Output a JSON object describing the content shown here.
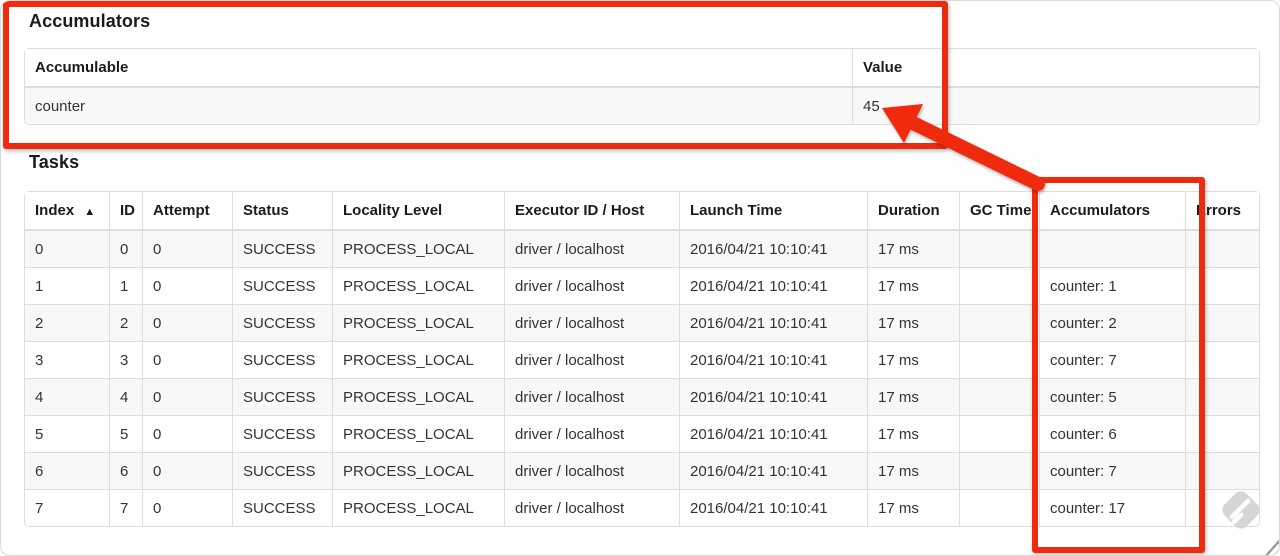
{
  "accumulators": {
    "heading": "Accumulators",
    "columns": [
      "Accumulable",
      "Value"
    ],
    "rows": [
      [
        "counter",
        "45"
      ]
    ]
  },
  "tasks": {
    "heading": "Tasks",
    "sort_icon": "▲",
    "columns": [
      "Index",
      "ID",
      "Attempt",
      "Status",
      "Locality Level",
      "Executor ID / Host",
      "Launch Time",
      "Duration",
      "GC Time",
      "Accumulators",
      "Errors"
    ],
    "rows": [
      [
        "0",
        "0",
        "0",
        "SUCCESS",
        "PROCESS_LOCAL",
        "driver / localhost",
        "2016/04/21 10:10:41",
        "17 ms",
        "",
        "",
        ""
      ],
      [
        "1",
        "1",
        "0",
        "SUCCESS",
        "PROCESS_LOCAL",
        "driver / localhost",
        "2016/04/21 10:10:41",
        "17 ms",
        "",
        "counter: 1",
        ""
      ],
      [
        "2",
        "2",
        "0",
        "SUCCESS",
        "PROCESS_LOCAL",
        "driver / localhost",
        "2016/04/21 10:10:41",
        "17 ms",
        "",
        "counter: 2",
        ""
      ],
      [
        "3",
        "3",
        "0",
        "SUCCESS",
        "PROCESS_LOCAL",
        "driver / localhost",
        "2016/04/21 10:10:41",
        "17 ms",
        "",
        "counter: 7",
        ""
      ],
      [
        "4",
        "4",
        "0",
        "SUCCESS",
        "PROCESS_LOCAL",
        "driver / localhost",
        "2016/04/21 10:10:41",
        "17 ms",
        "",
        "counter: 5",
        ""
      ],
      [
        "5",
        "5",
        "0",
        "SUCCESS",
        "PROCESS_LOCAL",
        "driver / localhost",
        "2016/04/21 10:10:41",
        "17 ms",
        "",
        "counter: 6",
        ""
      ],
      [
        "6",
        "6",
        "0",
        "SUCCESS",
        "PROCESS_LOCAL",
        "driver / localhost",
        "2016/04/21 10:10:41",
        "17 ms",
        "",
        "counter: 7",
        ""
      ],
      [
        "7",
        "7",
        "0",
        "SUCCESS",
        "PROCESS_LOCAL",
        "driver / localhost",
        "2016/04/21 10:10:41",
        "17 ms",
        "",
        "counter: 17",
        ""
      ]
    ]
  },
  "annotations": {
    "red": "#ef2b0d",
    "watermark_gray": "#d6d6d6"
  }
}
